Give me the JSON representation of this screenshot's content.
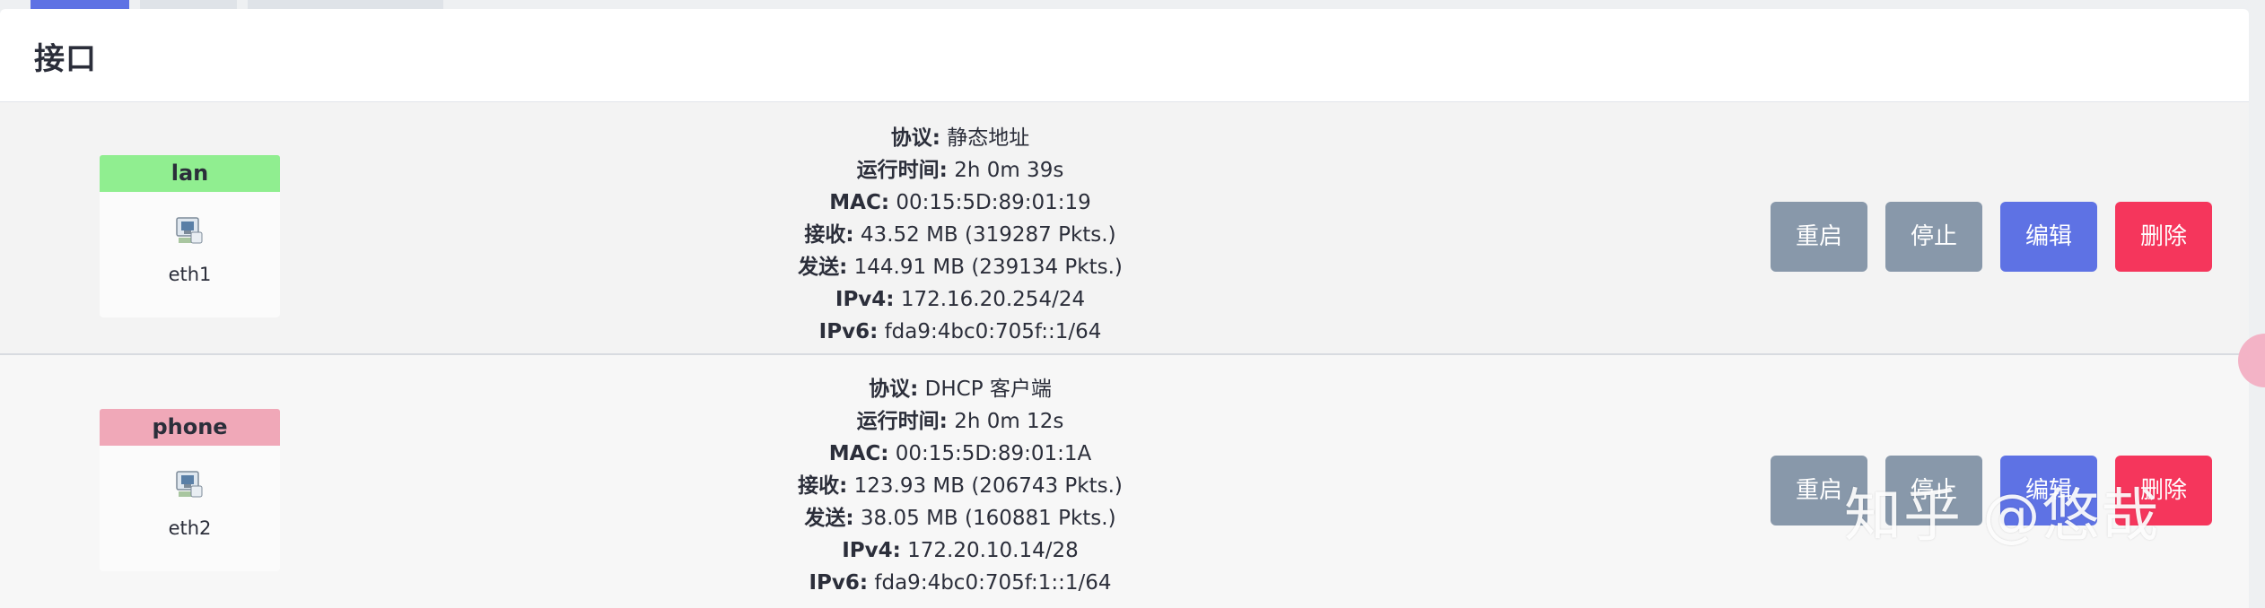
{
  "title": "接口",
  "colors": {
    "accent": "#5e72e4",
    "lan_badge": "#90ee90",
    "phone_badge": "#f0a8b8",
    "restart_btn": "#8898aa",
    "stop_btn": "#8898aa",
    "edit_btn": "#5e72e4",
    "delete_btn": "#f5365c"
  },
  "labels": {
    "protocol": "协议:",
    "uptime": "运行时间:",
    "mac": "MAC:",
    "rx": "接收:",
    "tx": "发送:",
    "ipv4": "IPv4:",
    "ipv6": "IPv6:"
  },
  "buttons": {
    "restart": "重启",
    "stop": "停止",
    "edit": "编辑",
    "delete": "删除"
  },
  "interfaces": [
    {
      "name": "lan",
      "device": "eth1",
      "icon": "ethernet-port-icon",
      "protocol": "静态地址",
      "uptime": "2h 0m 39s",
      "mac": "00:15:5D:89:01:19",
      "rx": "43.52 MB (319287 Pkts.)",
      "tx": "144.91 MB (239134 Pkts.)",
      "ipv4": "172.16.20.254/24",
      "ipv6": "fda9:4bc0:705f::1/64"
    },
    {
      "name": "phone",
      "device": "eth2",
      "icon": "ethernet-port-icon",
      "protocol": "DHCP 客户端",
      "uptime": "2h 0m 12s",
      "mac": "00:15:5D:89:01:1A",
      "rx": "123.93 MB (206743 Pkts.)",
      "tx": "38.05 MB (160881 Pkts.)",
      "ipv4": "172.20.10.14/28",
      "ipv6": "fda9:4bc0:705f:1::1/64"
    }
  ],
  "watermark": "知乎 @悠哉"
}
